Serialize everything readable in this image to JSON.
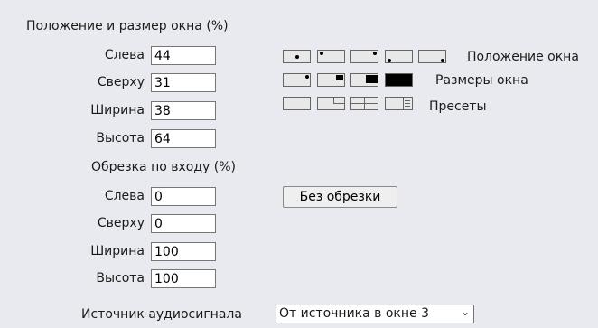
{
  "window": {
    "title": "Положение и размер окна (%)",
    "fields": [
      {
        "label": "Слева",
        "value": "44"
      },
      {
        "label": "Сверху",
        "value": "31"
      },
      {
        "label": "Ширина",
        "value": "38"
      },
      {
        "label": "Высота",
        "value": "64"
      }
    ],
    "position_label": "Положение окна",
    "sizes_label": "Размеры окна",
    "presets_label": "Пресеты"
  },
  "crop": {
    "title": "Обрезка по входу (%)",
    "fields": [
      {
        "label": "Слева",
        "value": "0"
      },
      {
        "label": "Сверху",
        "value": "0"
      },
      {
        "label": "Ширина",
        "value": "100"
      },
      {
        "label": "Высота",
        "value": "100"
      }
    ],
    "no_crop_label": "Без обрезки"
  },
  "audio": {
    "label": "Источник аудиосигнала",
    "selected": "От источника в окне 3"
  }
}
